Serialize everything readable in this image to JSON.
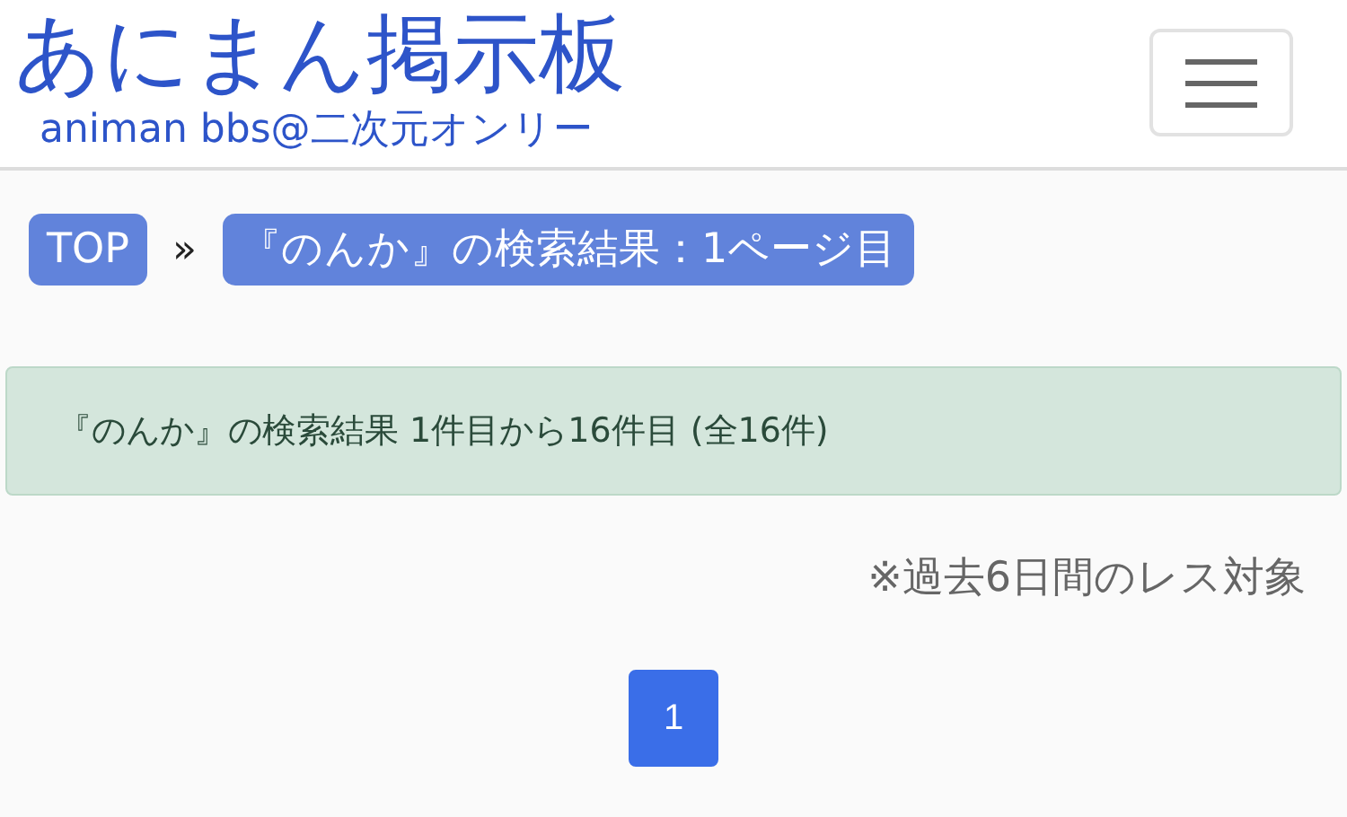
{
  "header": {
    "title": "あにまん掲示板",
    "subtitle": "animan bbs@二次元オンリー"
  },
  "breadcrumb": {
    "items": [
      "TOP",
      "『のんか』の検索結果：1ページ目"
    ],
    "separator": "»"
  },
  "result_alert": "『のんか』の検索結果 1件目から16件目 (全16件)",
  "note": "※過去6日間のレス対象",
  "pagination": [
    {
      "label": "1",
      "selected": true
    }
  ]
}
